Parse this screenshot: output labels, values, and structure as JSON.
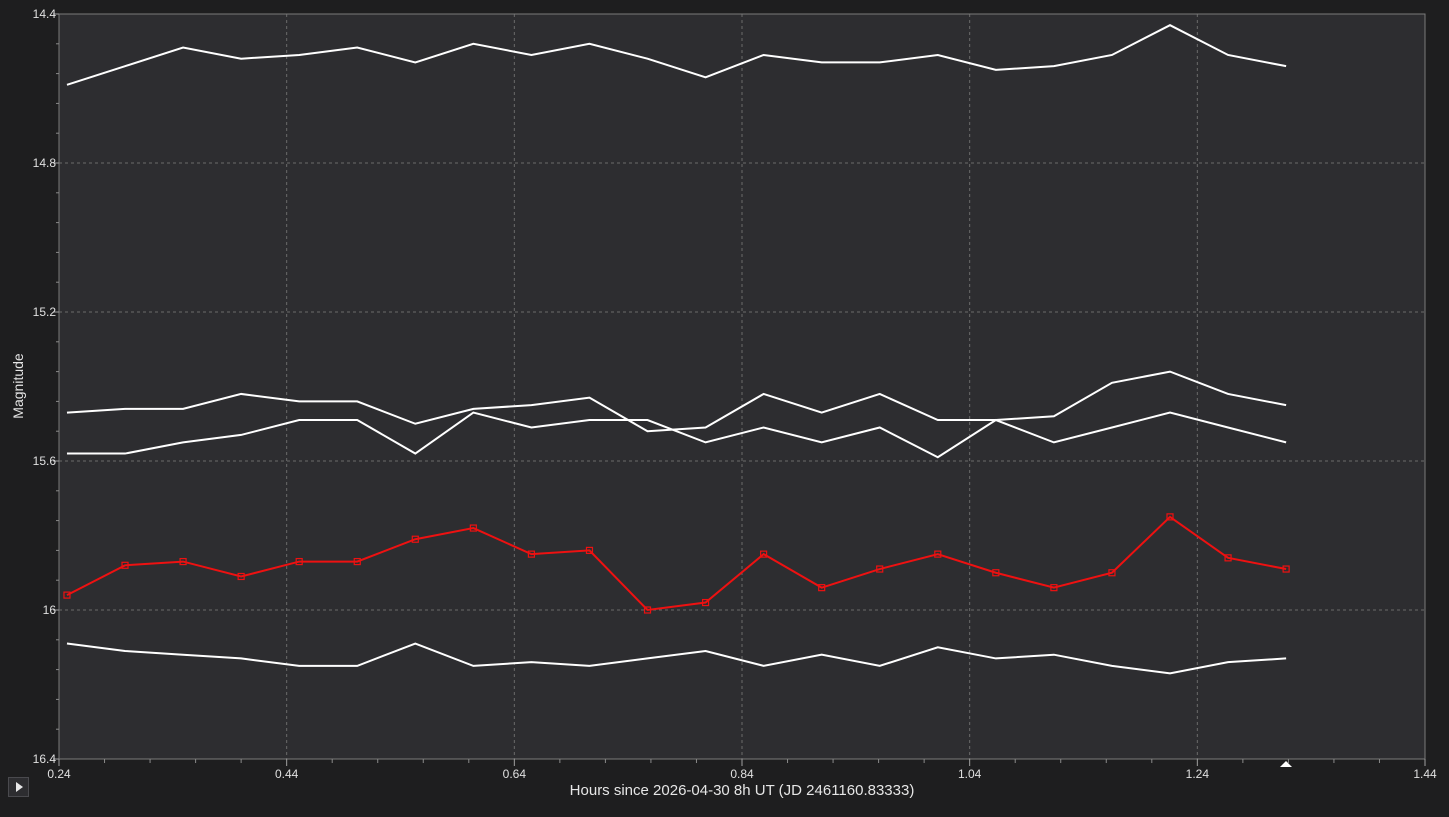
{
  "chart_data": {
    "type": "line",
    "xlabel": "Hours since 2026-04-30 8h UT (JD 2461160.83333)",
    "ylabel": "Magnitude",
    "xlim": [
      0.24,
      1.44
    ],
    "ylim": [
      14.4,
      16.4
    ],
    "y_inverted": true,
    "grid": true,
    "xticks": [
      "0.24",
      "0.44",
      "0.64",
      "0.84",
      "1.04",
      "1.24",
      "1.44"
    ],
    "yticks": [
      "14.4",
      "14.8",
      "15.2",
      "15.6",
      "16",
      "16.4"
    ],
    "x": [
      0.247,
      0.298,
      0.349,
      0.4,
      0.451,
      0.502,
      0.553,
      0.604,
      0.655,
      0.706,
      0.757,
      0.808,
      0.859,
      0.91,
      0.961,
      1.012,
      1.063,
      1.114,
      1.165,
      1.216,
      1.267,
      1.318
    ],
    "series": [
      {
        "color": "#ffffff",
        "marker": "none",
        "values": [
          14.59,
          14.54,
          14.49,
          14.52,
          14.51,
          14.49,
          14.53,
          14.48,
          14.51,
          14.48,
          14.52,
          14.57,
          14.51,
          14.53,
          14.53,
          14.51,
          14.55,
          14.54,
          14.51,
          14.43,
          14.51,
          14.54
        ]
      },
      {
        "color": "#ffffff",
        "marker": "none",
        "values": [
          15.47,
          15.46,
          15.46,
          15.42,
          15.44,
          15.44,
          15.5,
          15.46,
          15.45,
          15.43,
          15.52,
          15.51,
          15.42,
          15.47,
          15.42,
          15.49,
          15.49,
          15.48,
          15.39,
          15.36,
          15.42,
          15.45
        ]
      },
      {
        "color": "#ffffff",
        "marker": "none",
        "values": [
          15.58,
          15.58,
          15.55,
          15.53,
          15.49,
          15.49,
          15.58,
          15.47,
          15.51,
          15.49,
          15.49,
          15.55,
          15.51,
          15.55,
          15.51,
          15.59,
          15.49,
          15.55,
          15.51,
          15.47,
          15.51,
          15.55
        ]
      },
      {
        "color": "#ee1111",
        "marker": "square",
        "values": [
          15.96,
          15.88,
          15.87,
          15.91,
          15.87,
          15.87,
          15.81,
          15.78,
          15.85,
          15.84,
          16.0,
          15.98,
          15.85,
          15.94,
          15.89,
          15.85,
          15.9,
          15.94,
          15.9,
          15.75,
          15.86,
          15.89
        ]
      },
      {
        "color": "#ffffff",
        "marker": "none",
        "values": [
          16.09,
          16.11,
          16.12,
          16.13,
          16.15,
          16.15,
          16.09,
          16.15,
          16.14,
          16.15,
          16.13,
          16.11,
          16.15,
          16.12,
          16.15,
          16.1,
          16.13,
          16.12,
          16.15,
          16.17,
          16.14,
          16.13
        ]
      }
    ]
  }
}
